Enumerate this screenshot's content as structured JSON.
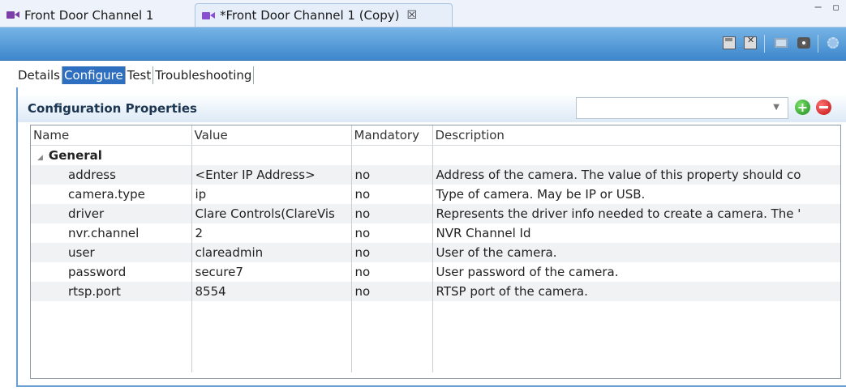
{
  "editor_tabs": [
    {
      "label": "Front Door Channel 1",
      "icon": "camera-icon",
      "active": false
    },
    {
      "label": "*Front Door Channel 1 (Copy)",
      "icon": "camera-icon",
      "active": true,
      "close_glyph": "☒"
    }
  ],
  "window_controls": {
    "glyph": "− ▫"
  },
  "toolbar": {
    "buttons": [
      "save-icon",
      "save-all-icon",
      "monitor-icon",
      "view-icon",
      "settings-icon"
    ]
  },
  "sub_tabs": [
    "Details",
    "Configure",
    "Test",
    "Troubleshooting"
  ],
  "selected_sub_tab": "Configure",
  "panel": {
    "title": "Configuration Properties",
    "combo": {
      "value": "",
      "arrow": "▼"
    },
    "add_glyph": "+"
  },
  "table": {
    "columns": [
      "Name",
      "Value",
      "Mandatory",
      "Description"
    ],
    "group": {
      "label": "General",
      "toggle": "◢"
    },
    "rows": [
      {
        "name": "address",
        "value": "<Enter IP Address>",
        "mandatory": "no",
        "description": "Address of the camera. The value of this property should co"
      },
      {
        "name": "camera.type",
        "value": "ip",
        "mandatory": "no",
        "description": "Type of camera. May be IP or USB."
      },
      {
        "name": "driver",
        "value": "Clare Controls(ClareVis",
        "mandatory": "no",
        "description": "Represents the driver info needed to create a camera. The '"
      },
      {
        "name": "nvr.channel",
        "value": "2",
        "mandatory": "no",
        "description": "NVR Channel Id"
      },
      {
        "name": "user",
        "value": "clareadmin",
        "mandatory": "no",
        "description": "User of the camera."
      },
      {
        "name": "password",
        "value": "secure7",
        "mandatory": "no",
        "description": "User password of the camera."
      },
      {
        "name": "rtsp.port",
        "value": "8554",
        "mandatory": "no",
        "description": "RTSP port of the camera."
      }
    ]
  },
  "colors": {
    "toolbar": "#4a93d4",
    "selected_tab": "#2f6fc0",
    "add": "#2a9a2a",
    "remove": "#d01a1a"
  }
}
